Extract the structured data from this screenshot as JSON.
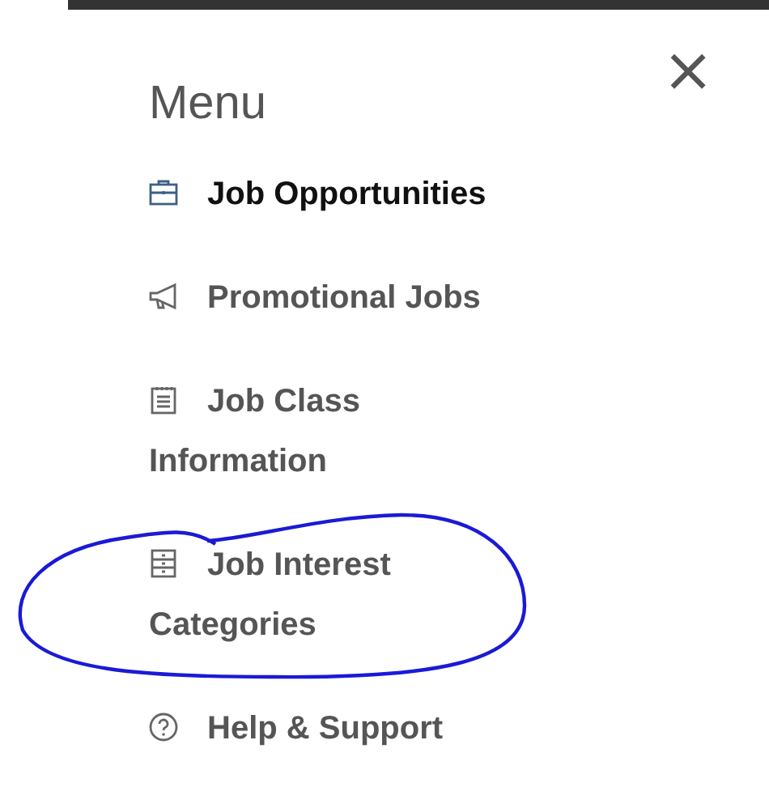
{
  "menu": {
    "title": "Menu",
    "close": "×",
    "items": [
      {
        "kind": "briefcase",
        "label": "Job Opportunities",
        "selected": true
      },
      {
        "kind": "megaphone",
        "label": "Promotional Jobs",
        "selected": false
      },
      {
        "kind": "notepad",
        "label": "Job Class Information",
        "selected": false
      },
      {
        "kind": "drawers",
        "label": "Job Interest Categories",
        "selected": false
      },
      {
        "kind": "help",
        "label": "Help & Support",
        "selected": false
      }
    ]
  }
}
